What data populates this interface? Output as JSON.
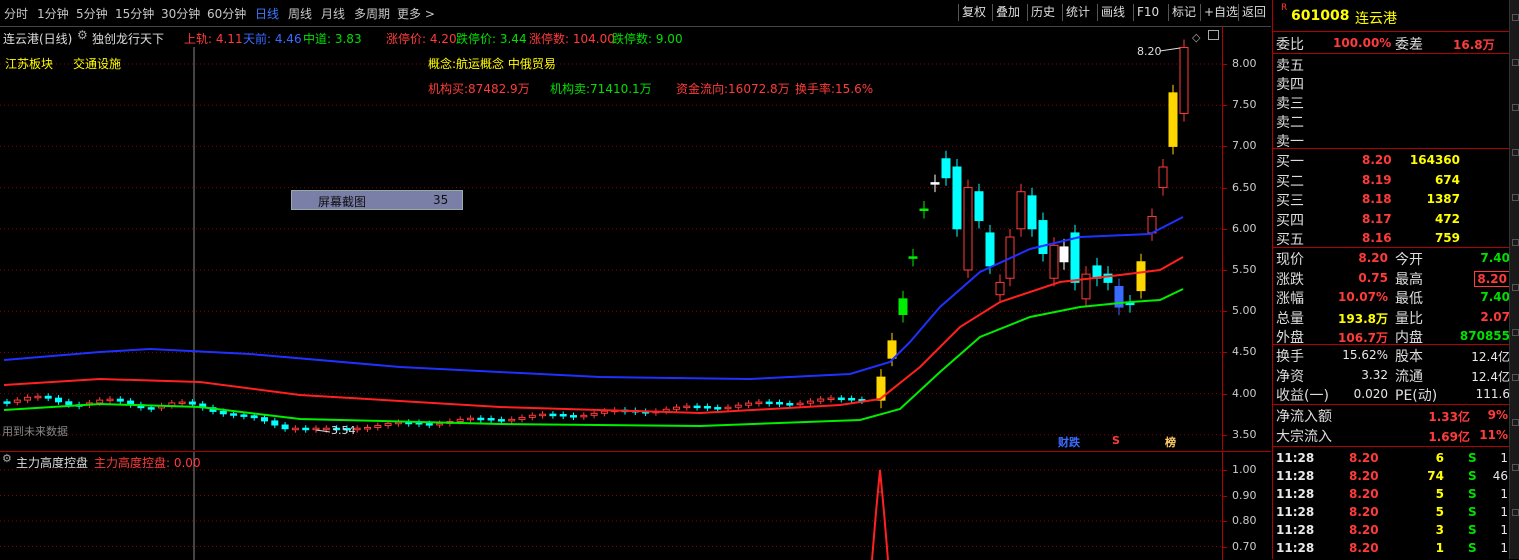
{
  "toolbar": {
    "periods": [
      "分时",
      "1分钟",
      "5分钟",
      "15分钟",
      "30分钟",
      "60分钟",
      "日线",
      "周线",
      "月线",
      "多周期",
      "更多 >"
    ],
    "active_period": "日线",
    "buttons": [
      "复权",
      "叠加",
      "历史",
      "统计",
      "画线",
      "F10",
      "标记",
      "+自选",
      "返回"
    ]
  },
  "chart_header": {
    "title": "连云港(日线)",
    "indicator": "独创龙行天下",
    "values": [
      {
        "label": "上轨: 4.11",
        "color": "#ff3b3b"
      },
      {
        "label": "天前: 4.46",
        "color": "#3a6bff"
      },
      {
        "label": "中道: 3.83",
        "color": "#00e000"
      },
      {
        "label": "涨停价: 4.20",
        "color": "#ff3b3b"
      },
      {
        "label": "跌停价: 3.44",
        "color": "#00e000"
      },
      {
        "label": "涨停数: 104.00",
        "color": "#ff3b3b"
      },
      {
        "label": "跌停数: 9.00",
        "color": "#00e000"
      }
    ],
    "sectors": [
      "江苏板块",
      "交通设施"
    ],
    "concept": "概念:航运概念 中俄贸易",
    "institution": [
      {
        "label": "机构买:87482.9万",
        "color": "#ff3b3b"
      },
      {
        "label": "机构卖:71410.1万",
        "color": "#00e000"
      },
      {
        "label": "资金流向:16072.8万",
        "color": "#ff3b3b"
      },
      {
        "label": "换手率:15.6%",
        "color": "#ff3b3b"
      }
    ],
    "screenshot_box_label": "屏幕截图",
    "screenshot_box_value": "35",
    "future_note": "用到未来数据",
    "high_marker": "8.20",
    "low_marker": "3.54",
    "event_labels": [
      {
        "text": "财跌",
        "color": "#3a6bff"
      },
      {
        "text": "S",
        "color": "#ff3b3b"
      },
      {
        "text": "榜",
        "color": "#ffcc66"
      }
    ]
  },
  "sub_header": {
    "name": "主力高度控盘",
    "value_label": "主力高度控盘: 0.00"
  },
  "right_panel": {
    "code": "601008",
    "name": "连云港",
    "weibi_label": "委比",
    "weibi_val": "100.00%",
    "weicha_label": "委差",
    "weicha_val": "16.8万",
    "sells": [
      "卖五",
      "卖四",
      "卖三",
      "卖二",
      "卖一"
    ],
    "buys": [
      {
        "label": "买一",
        "price": "8.20",
        "vol": "164360"
      },
      {
        "label": "买二",
        "price": "8.19",
        "vol": "674"
      },
      {
        "label": "买三",
        "price": "8.18",
        "vol": "1387"
      },
      {
        "label": "买四",
        "price": "8.17",
        "vol": "472"
      },
      {
        "label": "买五",
        "price": "8.16",
        "vol": "759"
      }
    ],
    "stats1": [
      {
        "l": "现价",
        "v": "8.20",
        "vc": "red",
        "l2": "今开",
        "v2": "7.40",
        "v2c": "green"
      },
      {
        "l": "涨跌",
        "v": "0.75",
        "vc": "red",
        "l2": "最高",
        "v2": "8.20",
        "v2c": "red"
      },
      {
        "l": "涨幅",
        "v": "10.07%",
        "vc": "red",
        "l2": "最低",
        "v2": "7.40",
        "v2c": "green"
      },
      {
        "l": "总量",
        "v": "193.8万",
        "vc": "yellow",
        "l2": "量比",
        "v2": "2.07",
        "v2c": "red"
      },
      {
        "l": "外盘",
        "v": "106.7万",
        "vc": "red",
        "l2": "内盘",
        "v2": "870855",
        "v2c": "green"
      }
    ],
    "stats2": [
      {
        "l": "换手",
        "v": "15.62%",
        "vc": "white",
        "l2": "股本",
        "v2": "12.4亿",
        "v2c": "white"
      },
      {
        "l": "净资",
        "v": "3.32",
        "vc": "white",
        "l2": "流通",
        "v2": "12.4亿",
        "v2c": "white"
      },
      {
        "l": "收益(一)",
        "v": "0.020",
        "vc": "white",
        "l2": "PE(动)",
        "v2": "111.6",
        "v2c": "white"
      }
    ],
    "flows": [
      {
        "l": "净流入额",
        "v": "1.33亿",
        "p": "9%"
      },
      {
        "l": "大宗流入",
        "v": "1.69亿",
        "p": "11%"
      }
    ],
    "ticks": [
      {
        "t": "11:28",
        "p": "8.20",
        "v": "6",
        "s": "S",
        "n": "1"
      },
      {
        "t": "11:28",
        "p": "8.20",
        "v": "74",
        "s": "S",
        "n": "46"
      },
      {
        "t": "11:28",
        "p": "8.20",
        "v": "5",
        "s": "S",
        "n": "1"
      },
      {
        "t": "11:28",
        "p": "8.20",
        "v": "5",
        "s": "S",
        "n": "1"
      },
      {
        "t": "11:28",
        "p": "8.20",
        "v": "3",
        "s": "S",
        "n": "1"
      },
      {
        "t": "11:28",
        "p": "8.20",
        "v": "1",
        "s": "S",
        "n": "1"
      }
    ]
  },
  "colors": {
    "up": "#ff3b3b",
    "down": "#00ffff",
    "limit_up": "#ffd700",
    "upper_band": "#ff2020",
    "mid_band": "#2030ff",
    "lower_band": "#00ee00",
    "grid": "#8b0000"
  },
  "axis_main": [
    "8.00",
    "7.50",
    "7.00",
    "6.50",
    "6.00",
    "5.50",
    "5.00",
    "4.50",
    "4.00",
    "3.50"
  ],
  "axis_sub": [
    "1.00",
    "0.90",
    "0.80",
    "0.70"
  ]
}
